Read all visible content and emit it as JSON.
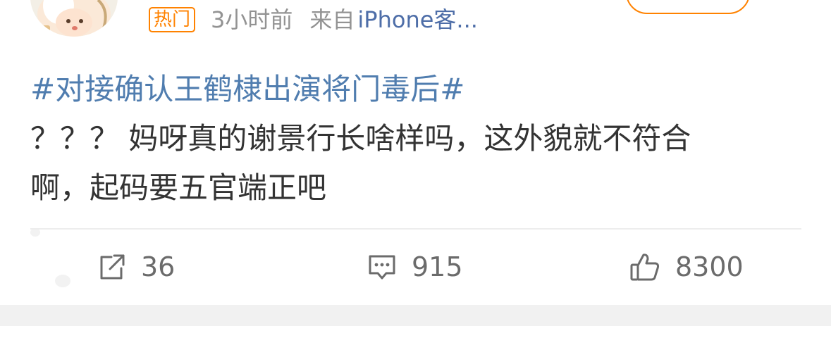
{
  "post": {
    "badge": "热门",
    "time": "3小时前",
    "source_prefix": "来自",
    "source_device": "iPhone客...",
    "topic": "#对接确认王鹤棣出演将门毒后#",
    "text_line1": "？？？ 妈呀真的谢景行长啥样吗，这外貌就不符合",
    "text_line2": "啊，起码要五官端正吧"
  },
  "actions": {
    "repost_count": "36",
    "comment_count": "915",
    "like_count": "8300"
  },
  "icons": {
    "repost": "share-icon",
    "comment": "comment-icon",
    "like": "thumbs-up-icon"
  },
  "colors": {
    "accent": "#ff8200",
    "topic_link": "#507daf",
    "meta_text": "#939393",
    "body_text": "#333333"
  }
}
